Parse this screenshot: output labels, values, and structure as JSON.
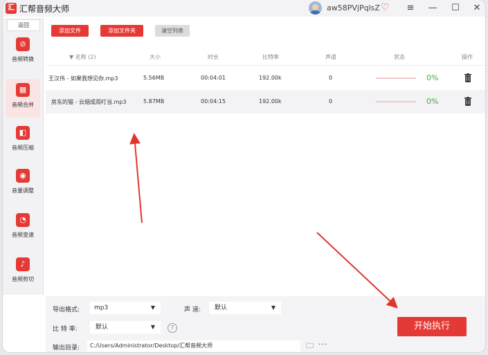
{
  "app": {
    "title": "汇帮音频大师",
    "logo_text": "汇",
    "username": "aw58PVjPqlsZ"
  },
  "window_controls": {
    "menu": "≡",
    "minimize": "—",
    "maximize": "☐",
    "close": "✕"
  },
  "sidebar": {
    "back_label": "返回",
    "items": [
      {
        "label": "音频转换",
        "icon": "audio-convert-icon",
        "glyph": "⊘"
      },
      {
        "label": "音频合并",
        "icon": "audio-merge-icon",
        "glyph": "▦"
      },
      {
        "label": "音频压缩",
        "icon": "audio-compress-icon",
        "glyph": "◧"
      },
      {
        "label": "音量调整",
        "icon": "volume-adjust-icon",
        "glyph": "◉"
      },
      {
        "label": "音频变速",
        "icon": "audio-speed-icon",
        "glyph": "◔"
      },
      {
        "label": "音频剪切",
        "icon": "audio-cut-icon",
        "glyph": "♪"
      }
    ]
  },
  "toolbar": {
    "add_file": "添加文件",
    "add_folder": "添加文件夹",
    "clear_list": "清空列表"
  },
  "table": {
    "columns": {
      "name": "名称 (2)",
      "size": "大小",
      "duration": "时长",
      "bitrate": "比特率",
      "channel": "声道",
      "status": "状态",
      "action": "操作"
    },
    "rows": [
      {
        "name": "王汉伟 - 如果我想见你.mp3",
        "size": "5.56MB",
        "duration": "00:04:01",
        "bitrate": "192.00k",
        "channel": "0",
        "percent": "0%",
        "progress": 0
      },
      {
        "name": "房东的猫 - 云烟成雨叮当.mp3",
        "size": "5.87MB",
        "duration": "00:04:15",
        "bitrate": "192.00k",
        "channel": "0",
        "percent": "0%",
        "progress": 0
      }
    ]
  },
  "bottom": {
    "format_label": "导出格式:",
    "format_value": "mp3",
    "channel_label": "声 道:",
    "channel_value": "默认",
    "bitrate_label": "比 特 率:",
    "bitrate_value": "默认",
    "output_label": "输出目录:",
    "output_path": "C:/Users/Administrator/Desktop/汇帮音频大师",
    "start_button": "开始执行",
    "help_glyph": "?",
    "folder_glyph": "🗀",
    "more_glyph": "···"
  },
  "colors": {
    "accent": "#e53935",
    "progress_text": "#3ab14a",
    "arrow": "#e0362c"
  }
}
